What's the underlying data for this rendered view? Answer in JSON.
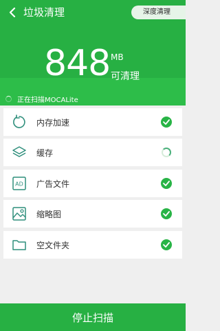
{
  "header": {
    "title": "垃圾清理",
    "deep_clean_label": "深度清理",
    "size_value": "848",
    "size_unit": "MB",
    "size_caption": "可清理",
    "scan_status": "正在扫描MOCALite"
  },
  "items": [
    {
      "label": "内存加速",
      "icon": "refresh-icon",
      "status": "done"
    },
    {
      "label": "缓存",
      "icon": "layers-icon",
      "status": "scanning"
    },
    {
      "label": "广告文件",
      "icon": "ad-icon",
      "status": "done"
    },
    {
      "label": "缩略图",
      "icon": "image-icon",
      "status": "done"
    },
    {
      "label": "空文件夹",
      "icon": "folder-icon",
      "status": "done"
    }
  ],
  "footer": {
    "stop_label": "停止扫描"
  },
  "colors": {
    "brand_green": "#27b043",
    "check_green": "#28b446",
    "icon_teal": "#2f8f7c"
  }
}
